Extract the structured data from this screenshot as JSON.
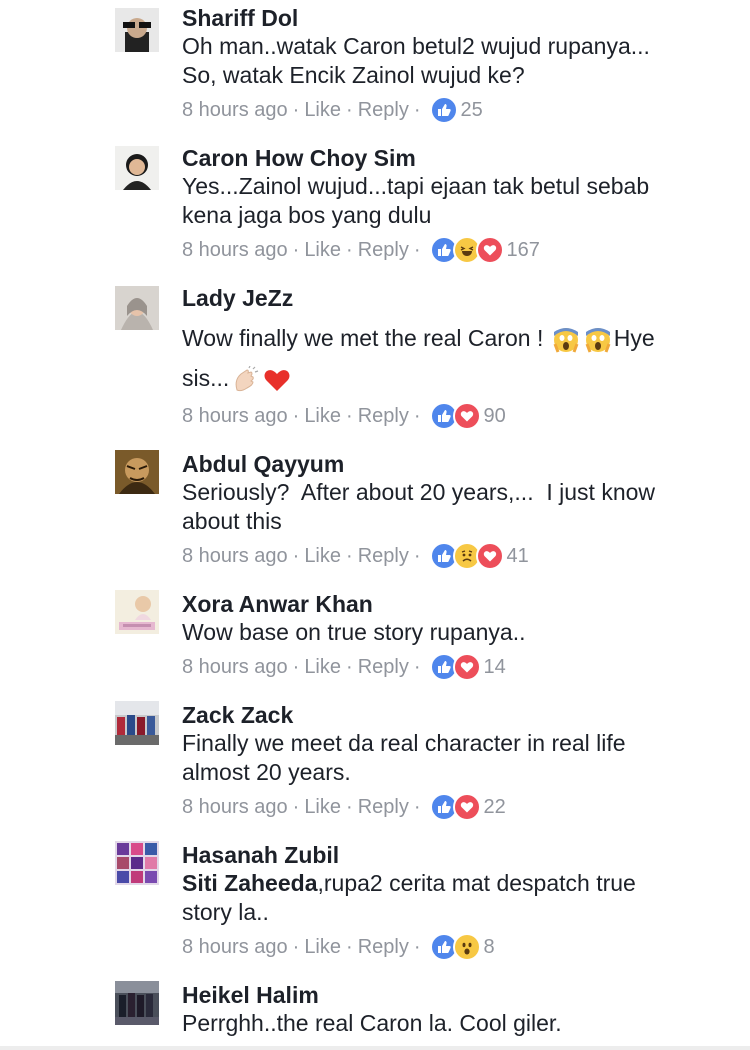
{
  "comments": [
    {
      "name": "Shariff Dol",
      "lines": [
        "Oh man..watak Caron betul2 wujud rupanya...",
        "So, watak Encik Zainol wujud ke?"
      ],
      "time": "8 hours ago",
      "like": "Like",
      "reply": "Reply",
      "reactions": [
        "like"
      ],
      "count": "25"
    },
    {
      "name": "Caron How Choy Sim",
      "lines": [
        "Yes...Zainol wujud...tapi ejaan tak betul sebab",
        "kena jaga bos yang dulu"
      ],
      "time": "8 hours ago",
      "like": "Like",
      "reply": "Reply",
      "reactions": [
        "like",
        "haha",
        "love"
      ],
      "count": "167"
    },
    {
      "name": "Lady JeZz",
      "line1": "Wow finally we met the real Caron ! ",
      "line1b": "Hye",
      "line2": "sis...",
      "time": "8 hours ago",
      "like": "Like",
      "reply": "Reply",
      "reactions": [
        "like",
        "love"
      ],
      "count": "90"
    },
    {
      "name": "Abdul Qayyum",
      "lines": [
        "Seriously?  After about 20 years,...  I just know",
        "about this"
      ],
      "time": "8 hours ago",
      "like": "Like",
      "reply": "Reply",
      "reactions": [
        "like",
        "sad",
        "love"
      ],
      "count": "41"
    },
    {
      "name": "Xora Anwar Khan",
      "lines": [
        "Wow base on true story rupanya.."
      ],
      "time": "8 hours ago",
      "like": "Like",
      "reply": "Reply",
      "reactions": [
        "like",
        "love"
      ],
      "count": "14"
    },
    {
      "name": "Zack Zack",
      "lines": [
        "Finally we meet da real character in real life",
        "almost 20 years."
      ],
      "time": "8 hours ago",
      "like": "Like",
      "reply": "Reply",
      "reactions": [
        "like",
        "love"
      ],
      "count": "22"
    },
    {
      "name": "Hasanah Zubil",
      "mention": "Siti Zaheeda",
      "line1_rest": ",rupa2 cerita mat despatch true",
      "line2": "story la..",
      "time": "8 hours ago",
      "like": "Like",
      "reply": "Reply",
      "reactions": [
        "like",
        "wow"
      ],
      "count": "8"
    },
    {
      "name": "Heikel Halim",
      "lines": [
        "Perrghh..the real Caron la. Cool giler."
      ]
    }
  ],
  "separator": "·",
  "colors": {
    "text": "#1d2129",
    "meta": "#90949c",
    "like": "#4f86ec",
    "love": "#ed4e5a",
    "face": "#f7c844"
  }
}
